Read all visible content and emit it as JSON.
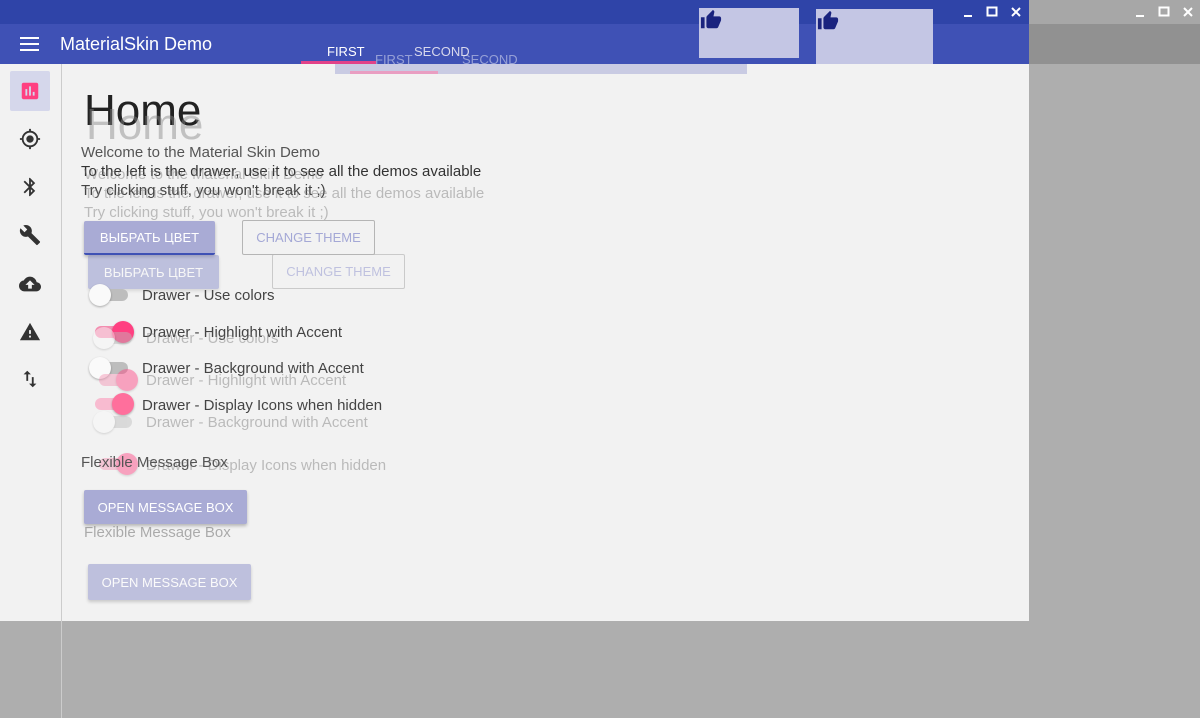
{
  "app": {
    "title": "MaterialSkin Demo"
  },
  "tabs": {
    "first": "FIRST",
    "second": "SECOND"
  },
  "page": {
    "heading": "Home",
    "lines": [
      "Welcome to the Material Skin Demo",
      "To the left is the drawer, use it to see all the demos available",
      "Try clicking stuff, you won't break it ;)"
    ]
  },
  "buttons": {
    "pick_color": "ВЫБРАТЬ ЦВЕТ",
    "change_theme": "CHANGE THEME",
    "open_message_box": "OPEN MESSAGE BOX"
  },
  "toggles": [
    {
      "label": "Drawer - Use colors",
      "checked": false
    },
    {
      "label": "Drawer - Highlight with Accent",
      "checked": true
    },
    {
      "label": "Drawer - Background with Accent",
      "checked": false
    },
    {
      "label": "Drawer - Display Icons when hidden",
      "checked": true
    }
  ],
  "sections": {
    "message_box": "Flexible Message Box"
  },
  "nav_icons": [
    "chart-icon",
    "crosshair-icon",
    "bluetooth-icon",
    "wrench-icon",
    "cloud-upload-icon",
    "warning-icon",
    "swap-vertical-icon"
  ],
  "colors": {
    "primary": "#3f51b5",
    "primary_dark": "#2f44a8",
    "accent": "#ff4081",
    "surface": "#f2f2f2",
    "backdrop": "#aeaeae"
  }
}
